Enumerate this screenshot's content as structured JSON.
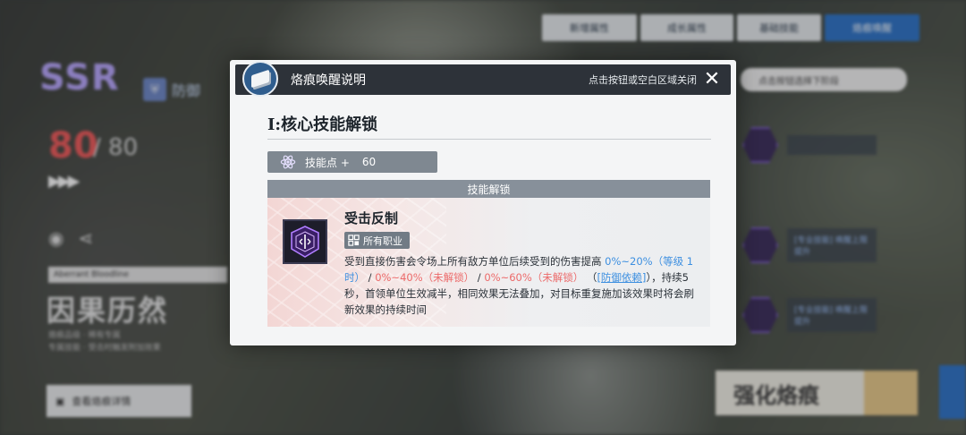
{
  "background": {
    "top_tabs": [
      "新增属性",
      "成长属性",
      "基础技能",
      "烙痕唤醒"
    ],
    "active_tab": 3,
    "rarity": "SSR",
    "role": "防御",
    "level": "80",
    "level_max": "/ 80",
    "name_tag": "Aberrant Bloodline",
    "character_name": "因果历然",
    "small_lines": [
      "烙痕品级 · 稀有专属",
      "专属技能 · 受击时触发附加效果"
    ],
    "view_button": "查看烙痕详情",
    "strengthen_button": "强化烙痕",
    "right_note": "点击按钮选择下阶段",
    "right_slots": [
      {
        "label": "[专业技能]\n唤醒上限提升"
      },
      {
        "label": "[专业技能]\n唤醒上限提升"
      }
    ]
  },
  "modal": {
    "title": "烙痕唤醒说明",
    "close_hint": "点击按钮或空白区域关闭",
    "close_symbol": "✕",
    "section_title": "I:核心技能解锁",
    "skill_points_label": "技能点 +",
    "skill_points_value": "60",
    "unlock_header": "技能解锁",
    "skill": {
      "name": "受击反制",
      "job_tag": "所有职业",
      "desc_1": "受到直接伤害会令场上所有敌方单位后续受到的伤害提高 ",
      "val_1": "0%~20%（等级 1时）",
      "sep_1": " / ",
      "val_2": "0%~40%（未解锁）",
      "sep_2": " / ",
      "val_3": "0%~60%（未解锁）",
      "paren_open": " （",
      "link": "[防御依赖]",
      "paren_close": "）",
      "desc_2": "，持续5秒，首领单位生效减半，相同效果无法叠加，对目标重复施加该效果时将会刷新效果的持续时间"
    }
  },
  "colors": {
    "accent_blue": "#2e74c8",
    "value_blue": "#3d8fe0",
    "locked_red": "#ec6a6a",
    "header_dark": "#2d3239"
  }
}
